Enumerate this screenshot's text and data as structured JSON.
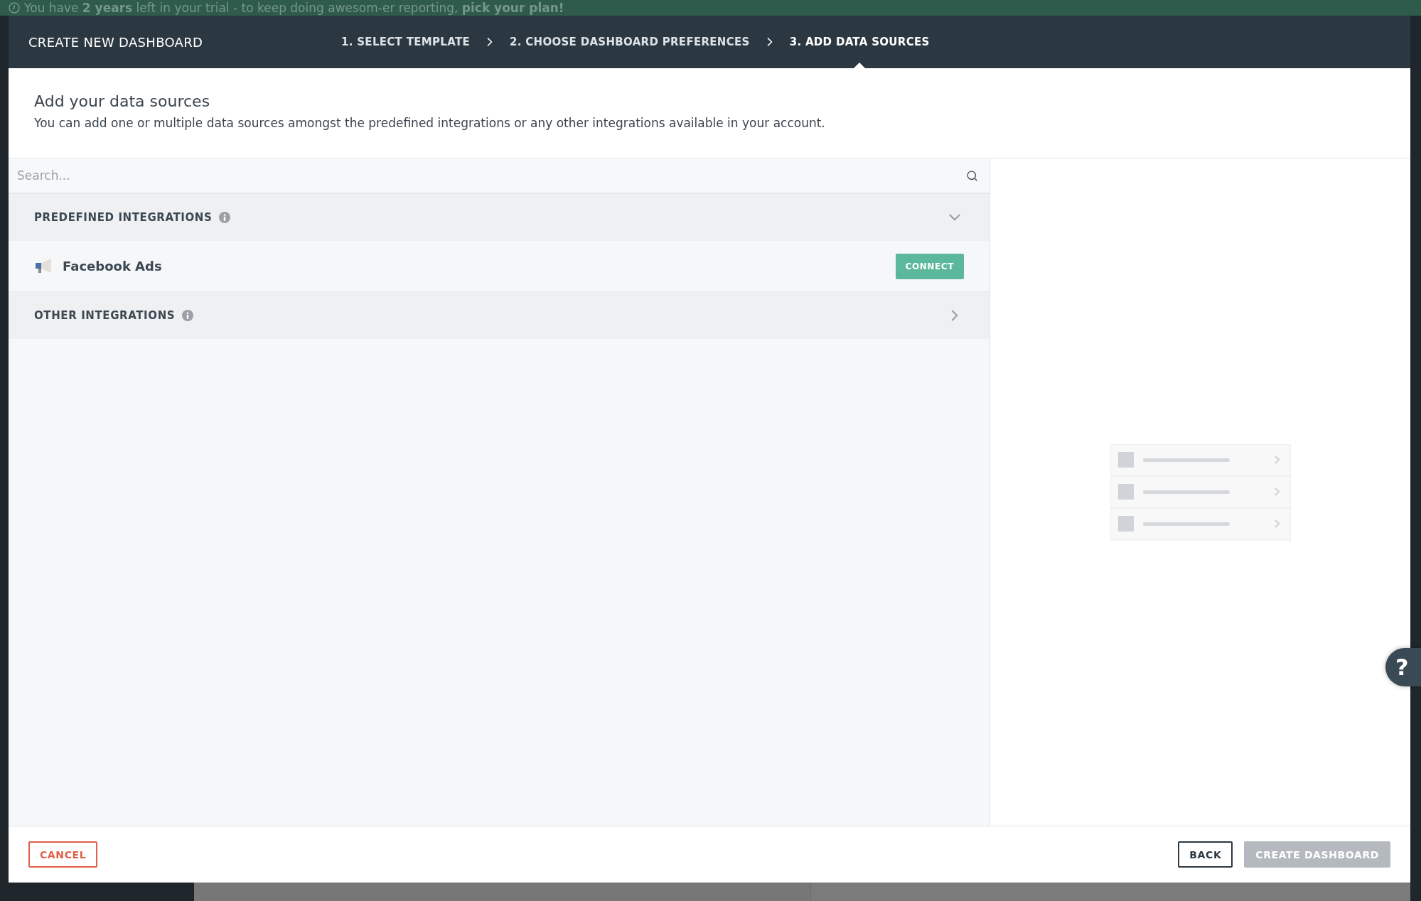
{
  "banner": {
    "text": "You have **2 years** left in your trial - to keep doing awesom-er reporting, **pick your plan!**"
  },
  "dialog": {
    "title": "CREATE NEW DASHBOARD",
    "steps": [
      {
        "label": "1. SELECT TEMPLATE",
        "selected": false
      },
      {
        "label": "2. CHOOSE DASHBOARD PREFERENCES",
        "selected": false
      },
      {
        "label": "3. ADD DATA SOURCES",
        "selected": true
      }
    ],
    "heading": "Add your data sources",
    "description": "You can add one or multiple data sources amongst the predefined integrations or any other integrations available in your account.",
    "search": {
      "placeholder": "Search..."
    },
    "sections": [
      {
        "title": "PREDEFINED INTEGRATIONS",
        "expanded": true,
        "items": [
          {
            "name": "Facebook Ads",
            "action": "CONNECT"
          }
        ]
      },
      {
        "title": "OTHER INTEGRATIONS",
        "expanded": false
      }
    ],
    "buttons": {
      "cancel": "CANCEL",
      "back": "BACK",
      "create": {
        "label": "CREATE DASHBOARD",
        "disabled": true
      }
    },
    "help": "?"
  }
}
